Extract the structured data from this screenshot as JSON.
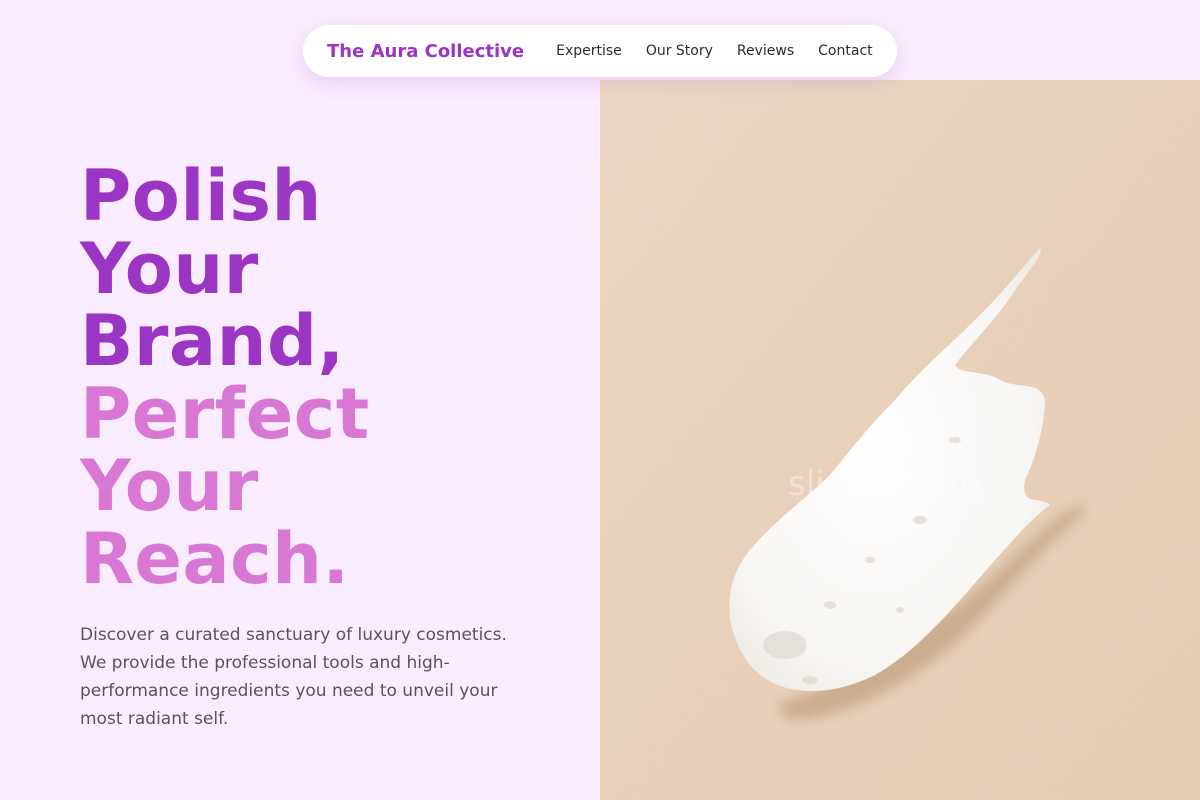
{
  "nav": {
    "brand": "The Aura Collective",
    "links": [
      "Expertise",
      "Our Story",
      "Reviews",
      "Contact"
    ]
  },
  "hero": {
    "title_lines_primary": [
      "Polish",
      "Your",
      "Brand,"
    ],
    "title_lines_accent": [
      "Perfect",
      "Your",
      "Reach."
    ],
    "description": "Discover a curated sanctuary of luxury cosmetics. We provide the professional tools and high-performance ingredients you need to unveil your most radiant self.",
    "image_watermark": "slick.beauty"
  },
  "colors": {
    "background": "#f9ecfe",
    "brand_purple": "#9b35c3",
    "accent_pink": "#d878d4",
    "body_text": "#545463",
    "image_backdrop": "#ecd5c0"
  }
}
